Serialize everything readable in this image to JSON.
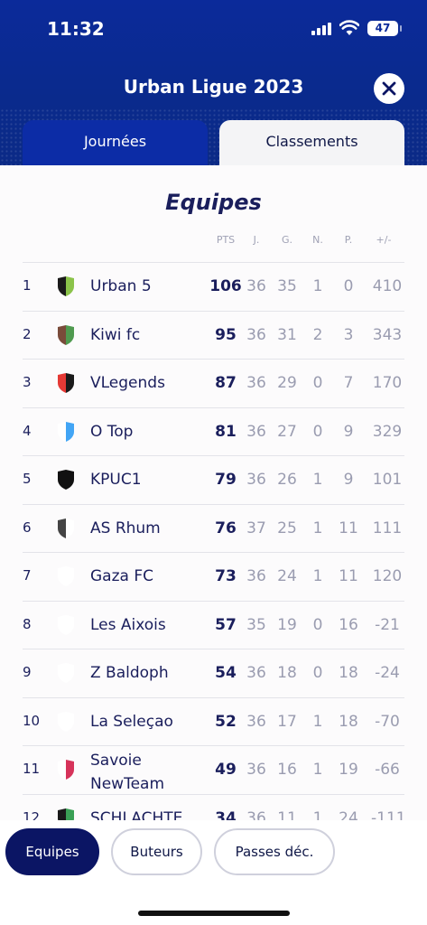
{
  "status_bar": {
    "time": "11:32",
    "battery": "47"
  },
  "header": {
    "title": "Urban Ligue 2023"
  },
  "tabs": [
    {
      "label": "Journées",
      "active": false
    },
    {
      "label": "Classements",
      "active": true
    }
  ],
  "section_title": "Equipes",
  "columns": [
    "PTS",
    "J.",
    "G.",
    "N.",
    "P.",
    "+/-"
  ],
  "rows": [
    {
      "rank": "1",
      "team": "Urban 5",
      "pts": "106",
      "j": "36",
      "g": "35",
      "n": "1",
      "p": "0",
      "diff": "410",
      "shield": [
        "#1a1a1a",
        "#8bc34a"
      ]
    },
    {
      "rank": "2",
      "team": "Kiwi fc",
      "pts": "95",
      "j": "36",
      "g": "31",
      "n": "2",
      "p": "3",
      "diff": "343",
      "shield": [
        "#7a4b3a",
        "#4f9a4f"
      ]
    },
    {
      "rank": "3",
      "team": "VLegends",
      "pts": "87",
      "j": "36",
      "g": "29",
      "n": "0",
      "p": "7",
      "diff": "170",
      "shield": [
        "#e53935",
        "#1a1a1a"
      ]
    },
    {
      "rank": "4",
      "team": "O Top",
      "pts": "81",
      "j": "36",
      "g": "27",
      "n": "0",
      "p": "9",
      "diff": "329",
      "shield": [
        "#ffffff",
        "#42a5f5"
      ]
    },
    {
      "rank": "5",
      "team": "KPUC1",
      "pts": "79",
      "j": "36",
      "g": "26",
      "n": "1",
      "p": "9",
      "diff": "101",
      "shield": [
        "#111111",
        "#111111"
      ]
    },
    {
      "rank": "6",
      "team": "AS Rhum",
      "pts": "76",
      "j": "37",
      "g": "25",
      "n": "1",
      "p": "11",
      "diff": "111",
      "shield": [
        "#444444",
        "#ffffff"
      ]
    },
    {
      "rank": "7",
      "team": "Gaza FC",
      "pts": "73",
      "j": "36",
      "g": "24",
      "n": "1",
      "p": "11",
      "diff": "120",
      "shield": [
        "#ffffff",
        "#ffffff"
      ]
    },
    {
      "rank": "8",
      "team": "Les Aixois",
      "pts": "57",
      "j": "35",
      "g": "19",
      "n": "0",
      "p": "16",
      "diff": "-21",
      "shield": [
        "#ffffff",
        "#ffffff"
      ]
    },
    {
      "rank": "9",
      "team": "Z Baldoph",
      "pts": "54",
      "j": "36",
      "g": "18",
      "n": "0",
      "p": "18",
      "diff": "-24",
      "shield": [
        "#ffffff",
        "#ffffff"
      ]
    },
    {
      "rank": "10",
      "team": "La Seleçao",
      "pts": "52",
      "j": "36",
      "g": "17",
      "n": "1",
      "p": "18",
      "diff": "-70",
      "shield": [
        "#ffffff",
        "#ffffff"
      ]
    },
    {
      "rank": "11",
      "team": "Savoie NewTeam",
      "pts": "49",
      "j": "36",
      "g": "16",
      "n": "1",
      "p": "19",
      "diff": "-66",
      "shield": [
        "#ffffff",
        "#d6335a"
      ]
    },
    {
      "rank": "12",
      "team": "SCHLACHTE",
      "pts": "34",
      "j": "36",
      "g": "11",
      "n": "1",
      "p": "24",
      "diff": "-111",
      "shield": [
        "#1a1a1a",
        "#3aa055"
      ]
    }
  ],
  "bottom_tabs": [
    {
      "label": "Equipes",
      "active": true
    },
    {
      "label": "Buteurs",
      "active": false
    },
    {
      "label": "Passes déc.",
      "active": false
    }
  ],
  "colors": {
    "header_blue": "#0b2a9a",
    "navy": "#0b1564",
    "text_dark": "#1a1e5c",
    "text_muted": "#9a9cb0"
  }
}
